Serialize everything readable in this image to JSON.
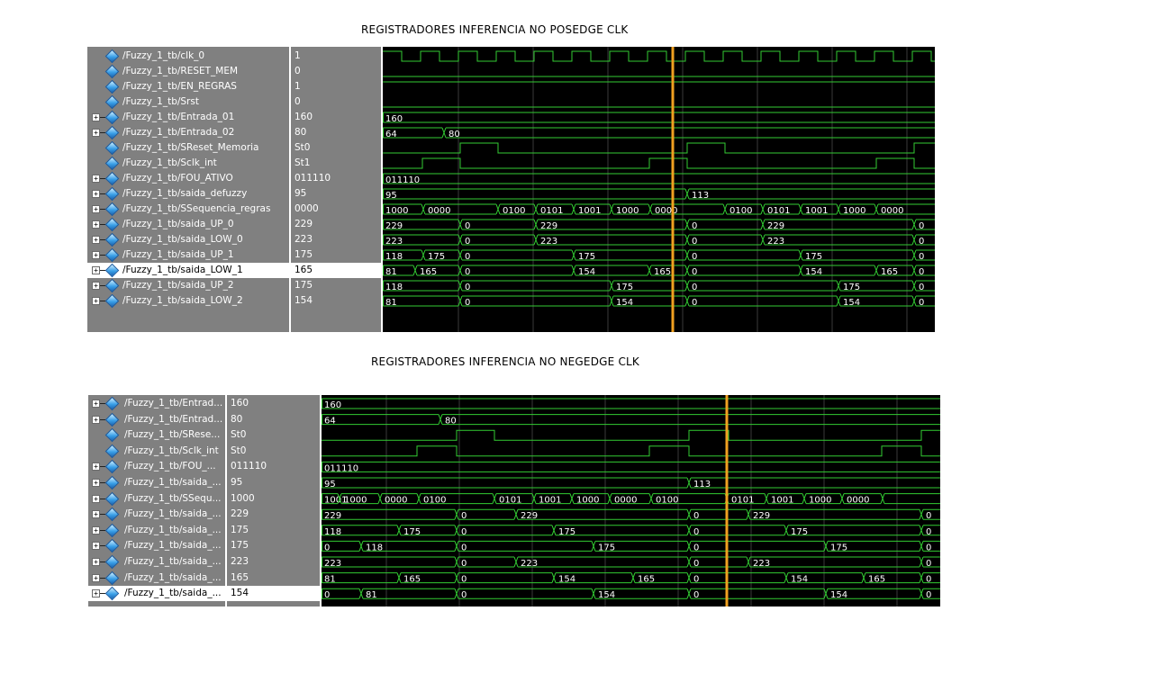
{
  "title_top": "REGISTRADORES INFERENCIA NO POSEDGE CLK",
  "title_bottom": "REGISTRADORES INFERENCIA NO NEGEDGE CLK",
  "colors": {
    "bg": "#000000",
    "wave": "#33cc33",
    "cursor": "#f0a020",
    "grid": "#3a3a3a",
    "text": "#ffffff"
  },
  "top": {
    "signals": [
      {
        "name": "/Fuzzy_1_tb/clk_0",
        "value": "1",
        "expand": false,
        "type": "clk"
      },
      {
        "name": "/Fuzzy_1_tb/RESET_MEM",
        "value": "0",
        "expand": false,
        "type": "low"
      },
      {
        "name": "/Fuzzy_1_tb/EN_REGRAS",
        "value": "1",
        "expand": false,
        "type": "high"
      },
      {
        "name": "/Fuzzy_1_tb/Srst",
        "value": "0",
        "expand": false,
        "type": "low"
      },
      {
        "name": "/Fuzzy_1_tb/Entrada_01",
        "value": "160",
        "expand": true,
        "type": "bus",
        "labels": [
          "160"
        ]
      },
      {
        "name": "/Fuzzy_1_tb/Entrada_02",
        "value": "80",
        "expand": true,
        "type": "bus",
        "labels": [
          "64",
          "80"
        ]
      },
      {
        "name": "/Fuzzy_1_tb/SReset_Memoria",
        "value": "St0",
        "expand": false,
        "type": "pulse"
      },
      {
        "name": "/Fuzzy_1_tb/Sclk_int",
        "value": "St1",
        "expand": false,
        "type": "pulse2"
      },
      {
        "name": "/Fuzzy_1_tb/FOU_ATIVO",
        "value": "011110",
        "expand": true,
        "type": "bus",
        "labels": [
          "011110"
        ]
      },
      {
        "name": "/Fuzzy_1_tb/saida_defuzzy",
        "value": "95",
        "expand": true,
        "type": "bus",
        "labels": [
          "95",
          "113"
        ]
      },
      {
        "name": "/Fuzzy_1_tb/SSequencia_regras",
        "value": "0000",
        "expand": true,
        "type": "bus",
        "labels": [
          "1000",
          "0000",
          "0100",
          "0101",
          "1001",
          "1000",
          "0000",
          "0100",
          "0101",
          "1001",
          "1000",
          "0000"
        ]
      },
      {
        "name": "/Fuzzy_1_tb/saida_UP_0",
        "value": "229",
        "expand": true,
        "type": "bus",
        "labels": [
          "229",
          "0",
          "229",
          "0",
          "229",
          "0"
        ]
      },
      {
        "name": "/Fuzzy_1_tb/saida_LOW_0",
        "value": "223",
        "expand": true,
        "type": "bus",
        "labels": [
          "223",
          "0",
          "223",
          "0",
          "223",
          "0"
        ]
      },
      {
        "name": "/Fuzzy_1_tb/saida_UP_1",
        "value": "175",
        "expand": true,
        "type": "bus",
        "labels": [
          "118",
          "175",
          "0",
          "175",
          "0",
          "175",
          "0"
        ]
      },
      {
        "name": "/Fuzzy_1_tb/saida_LOW_1",
        "value": "165",
        "expand": true,
        "type": "bus",
        "selected": true,
        "labels": [
          "81",
          "165",
          "0",
          "154",
          "165",
          "0",
          "154",
          "165",
          "0"
        ]
      },
      {
        "name": "/Fuzzy_1_tb/saida_UP_2",
        "value": "175",
        "expand": true,
        "type": "bus",
        "labels": [
          "118",
          "0",
          "175",
          "0",
          "175",
          "0"
        ]
      },
      {
        "name": "/Fuzzy_1_tb/saida_LOW_2",
        "value": "154",
        "expand": true,
        "type": "bus",
        "labels": [
          "81",
          "0",
          "154",
          "0",
          "154",
          "0"
        ]
      }
    ]
  },
  "bottom": {
    "signals": [
      {
        "name": "/Fuzzy_1_tb/Entrad...",
        "value": "160",
        "expand": true,
        "type": "bus",
        "labels": [
          "160"
        ]
      },
      {
        "name": "/Fuzzy_1_tb/Entrad...",
        "value": "80",
        "expand": true,
        "type": "bus",
        "labels": [
          "64",
          "80"
        ]
      },
      {
        "name": "/Fuzzy_1_tb/SRese...",
        "value": "St0",
        "expand": false,
        "type": "pulse"
      },
      {
        "name": "/Fuzzy_1_tb/Sclk_int",
        "value": "St0",
        "expand": false,
        "type": "pulse2"
      },
      {
        "name": "/Fuzzy_1_tb/FOU_...",
        "value": "011110",
        "expand": true,
        "type": "bus",
        "labels": [
          "011110"
        ]
      },
      {
        "name": "/Fuzzy_1_tb/saida_...",
        "value": "95",
        "expand": true,
        "type": "bus",
        "labels": [
          "95",
          "113"
        ]
      },
      {
        "name": "/Fuzzy_1_tb/SSequ...",
        "value": "1000",
        "expand": true,
        "type": "bus",
        "labels": [
          "1001",
          "1000",
          "0000",
          "0100",
          "0101",
          "1001",
          "1000",
          "0000",
          "0100",
          "0101",
          "1001",
          "1000",
          "0000"
        ]
      },
      {
        "name": "/Fuzzy_1_tb/saida_...",
        "value": "229",
        "expand": true,
        "type": "bus",
        "labels": [
          "229",
          "0",
          "229",
          "0",
          "229",
          "0"
        ]
      },
      {
        "name": "/Fuzzy_1_tb/saida_...",
        "value": "175",
        "expand": true,
        "type": "bus",
        "labels": [
          "118",
          "175",
          "0",
          "175",
          "0",
          "175",
          "0"
        ]
      },
      {
        "name": "/Fuzzy_1_tb/saida_...",
        "value": "175",
        "expand": true,
        "type": "bus",
        "labels": [
          "0",
          "118",
          "0",
          "175",
          "0",
          "175",
          "0"
        ]
      },
      {
        "name": "/Fuzzy_1_tb/saida_...",
        "value": "223",
        "expand": true,
        "type": "bus",
        "labels": [
          "223",
          "0",
          "223",
          "0",
          "223",
          "0"
        ]
      },
      {
        "name": "/Fuzzy_1_tb/saida_...",
        "value": "165",
        "expand": true,
        "type": "bus",
        "labels": [
          "81",
          "165",
          "0",
          "154",
          "165",
          "0",
          "154",
          "165",
          "0"
        ]
      },
      {
        "name": "/Fuzzy_1_tb/saida_...",
        "value": "154",
        "expand": true,
        "type": "bus",
        "selected": true,
        "labels": [
          "0",
          "81",
          "0",
          "154",
          "0",
          "154",
          "0"
        ]
      }
    ]
  }
}
